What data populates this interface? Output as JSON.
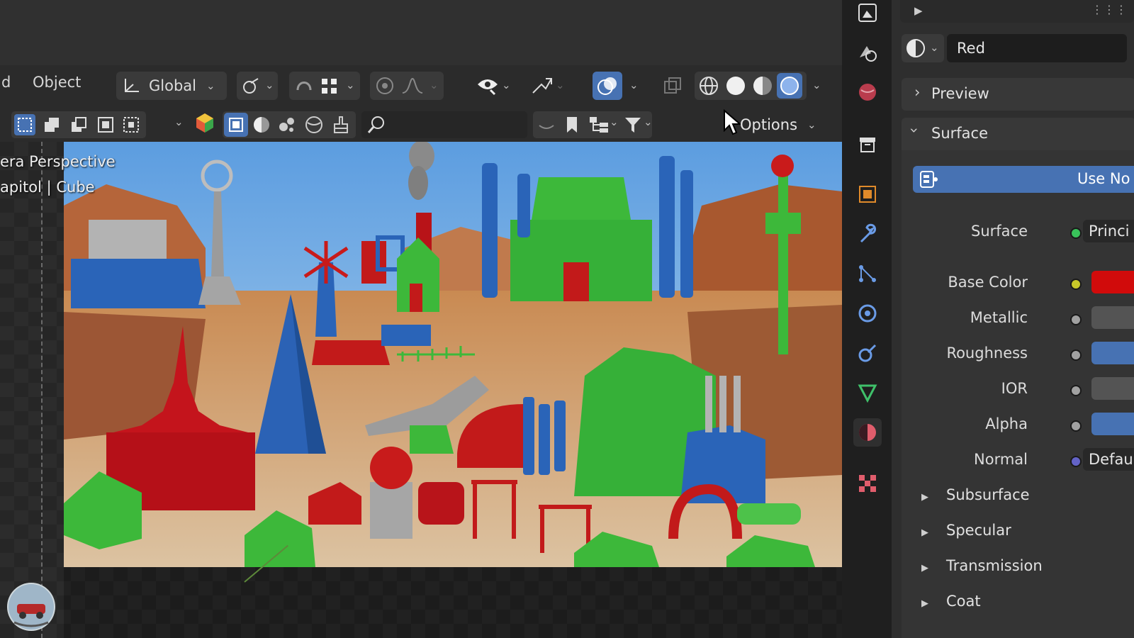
{
  "header": {
    "menu_partial": "d",
    "menu_object": "Object",
    "transform_orientation": "Global",
    "options_label": "Options"
  },
  "viewport": {
    "view_name": "era Perspective",
    "collection_info": "apitol | Cube"
  },
  "properties": {
    "material_name": "Red",
    "preview_label": "Preview",
    "surface_panel_label": "Surface",
    "use_nodes_label": "Use No",
    "rows": [
      {
        "label": "Surface",
        "value": "Princi"
      },
      {
        "label": "Base Color",
        "value": ""
      },
      {
        "label": "Metallic",
        "value": ""
      },
      {
        "label": "Roughness",
        "value": ""
      },
      {
        "label": "IOR",
        "value": ""
      },
      {
        "label": "Alpha",
        "value": ""
      },
      {
        "label": "Normal",
        "value": "Defau"
      }
    ],
    "subpanels": [
      "Subsurface",
      "Specular",
      "Transmission",
      "Coat"
    ]
  },
  "colors": {
    "accent_blue": "#4772b3",
    "base_color_red": "#d10b0b",
    "socket_yellow": "#c7c729",
    "socket_green": "#39c25a",
    "socket_purple": "#6363c7",
    "socket_gray": "#a1a1a1"
  },
  "icons": [
    "transform-orientation-icon",
    "pivot-icon",
    "snap-icon",
    "grid-snap-icon",
    "proportional-icon",
    "falloff-icon",
    "visibility-icon",
    "gizmo-icon",
    "overlay-icon",
    "xray-icon",
    "wireframe-shading-icon",
    "solid-shading-icon",
    "material-shading-icon",
    "rendered-shading-icon",
    "search-icon",
    "filter-icon",
    "material-icon",
    "render-icon",
    "output-icon",
    "view-layer-icon",
    "scene-icon",
    "world-icon",
    "collection-icon",
    "object-icon",
    "modifier-icon",
    "particles-icon",
    "physics-icon",
    "constraints-icon",
    "data-icon",
    "material-tab-icon",
    "texture-icon",
    "watermark-logo"
  ]
}
